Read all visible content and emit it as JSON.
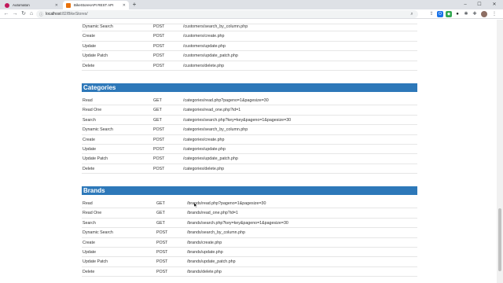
{
  "browser": {
    "tabs": [
      {
        "title": "Automaton",
        "active": false,
        "icon": "automaton-favicon",
        "color": "#c2185b"
      },
      {
        "title": "BikeStoresAPI REST API",
        "active": true,
        "icon": "bikestores-favicon",
        "color": "#e8710a"
      }
    ],
    "new_tab": "+",
    "url_host": "localhost",
    "url_path": ":82/BikeStores/",
    "window_controls": {
      "minimize": "–",
      "maximize": "☐",
      "close": "✕"
    },
    "nav": {
      "back": "←",
      "forward": "→",
      "reload": "↻",
      "home": "⌂"
    }
  },
  "customers": {
    "rows": [
      {
        "name": "Dynamic Search",
        "method": "POST",
        "path": "/customers/search_by_column.php"
      },
      {
        "name": "Create",
        "method": "POST",
        "path": "/customers/create.php"
      },
      {
        "name": "Update",
        "method": "POST",
        "path": "/customers/update.php"
      },
      {
        "name": "Update Patch",
        "method": "POST",
        "path": "/customers/update_patch.php"
      },
      {
        "name": "Delete",
        "method": "POST",
        "path": "/customers/delete.php"
      }
    ]
  },
  "categories": {
    "title": "Categories",
    "rows": [
      {
        "name": "Read",
        "method": "GET",
        "path": "/categories/read.php?pageno=1&pagesize=30"
      },
      {
        "name": "Read One",
        "method": "GET",
        "path": "/categories/read_one.php?id=1"
      },
      {
        "name": "Search",
        "method": "GET",
        "path": "/categories/search.php?key=key&pageno=1&pagesize=30"
      },
      {
        "name": "Dynamic Search",
        "method": "POST",
        "path": "/categories/search_by_column.php"
      },
      {
        "name": "Create",
        "method": "POST",
        "path": "/categories/create.php"
      },
      {
        "name": "Update",
        "method": "POST",
        "path": "/categories/update.php"
      },
      {
        "name": "Update Patch",
        "method": "POST",
        "path": "/categories/update_patch.php"
      },
      {
        "name": "Delete",
        "method": "POST",
        "path": "/categories/delete.php"
      }
    ]
  },
  "brands": {
    "title": "Brands",
    "rows": [
      {
        "name": "Read",
        "method": "GET",
        "path": "/brands/read.php?pageno=1&pagesize=30"
      },
      {
        "name": "Read One",
        "method": "GET",
        "path": "/brands/read_one.php?id=1"
      },
      {
        "name": "Search",
        "method": "GET",
        "path": "/brands/search.php?key=key&pageno=1&pagesize=30"
      },
      {
        "name": "Dynamic Search",
        "method": "POST",
        "path": "/brands/search_by_column.php"
      },
      {
        "name": "Create",
        "method": "POST",
        "path": "/brands/create.php"
      },
      {
        "name": "Update",
        "method": "POST",
        "path": "/brands/update.php"
      },
      {
        "name": "Update Patch",
        "method": "POST",
        "path": "/brands/update_patch.php"
      },
      {
        "name": "Delete",
        "method": "POST",
        "path": "/brands/delete.php"
      }
    ]
  },
  "colors": {
    "heading_bg": "#2d78b9",
    "heading_text": "#ffffff"
  }
}
